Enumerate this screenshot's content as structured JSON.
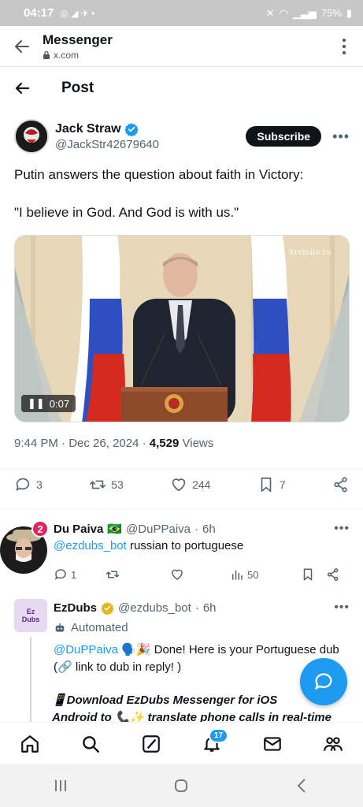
{
  "status_bar": {
    "time": "04:17",
    "battery": "75%"
  },
  "browser": {
    "app_title": "Messenger",
    "domain": "x.com"
  },
  "post_header": {
    "title": "Post"
  },
  "tweet": {
    "author_name": "Jack Straw",
    "handle": "@JackStr42679640",
    "subscribe_label": "Subscribe",
    "text": "Putin answers the question about faith in Victory:\n\n\"I believe in God. And God is with us.\"",
    "video_duration": "0:07",
    "watermark": "kremlin.ru",
    "time": "9:44 PM",
    "date": "Dec 26, 2024",
    "views_count": "4,529",
    "views_label": "Views",
    "replies": "3",
    "reposts": "53",
    "likes": "244",
    "bookmarks": "7"
  },
  "reply1": {
    "name": "Du Paiva",
    "flag": "🇧🇷",
    "handle": "@DuPPaiva",
    "time": "6h",
    "mention": "@ezdubs_bot",
    "text": " russian to portuguese",
    "notif_badge": "2",
    "replies": "1",
    "views": "50"
  },
  "reply2": {
    "name": "EzDubs",
    "handle": "@ezdubs_bot",
    "time": "6h",
    "avatar_text": "Ez\nDubs",
    "automated_label": "Automated",
    "mention": "@DuPPaiva",
    "emojis": "🗣️🎉",
    "text": " Done! Here is your Portuguese dub (🔗 link to dub in reply! )",
    "line1": "📱Download  EzDubs Messenger for iOS",
    "line2": "Android to 📞✨ translate phone calls in real-time"
  },
  "bottom_nav": {
    "notifications_count": "17"
  },
  "colors": {
    "accent": "#1d9bf0",
    "verified": "#1d9bf0",
    "gold_badge": "#e2b719"
  }
}
